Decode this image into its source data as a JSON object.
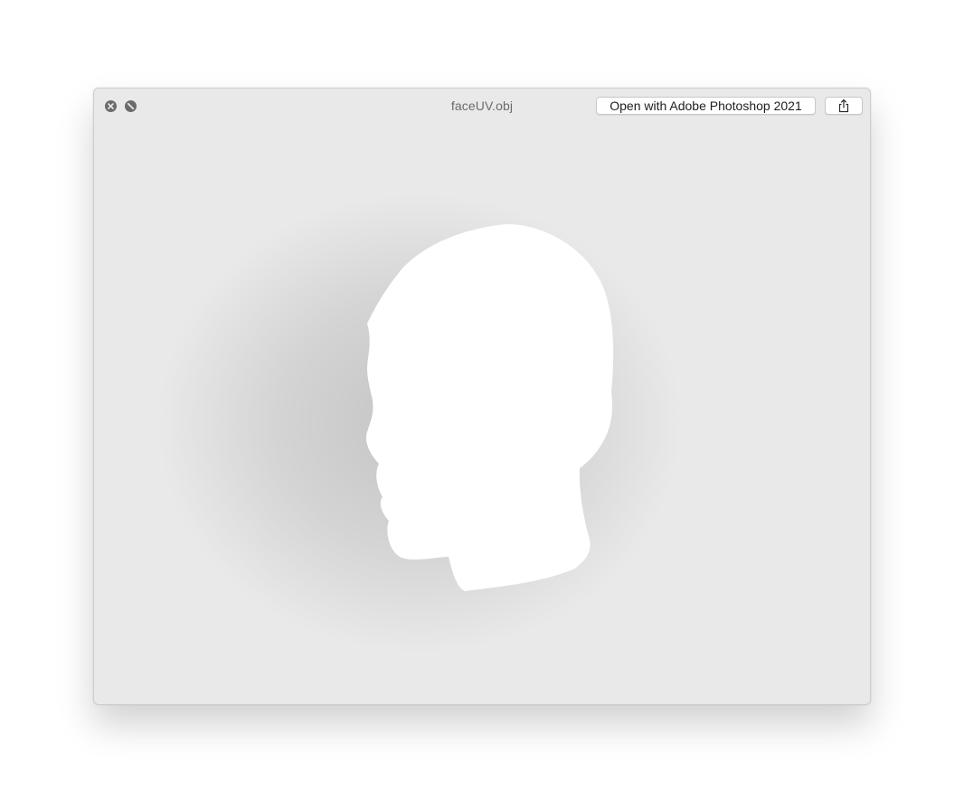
{
  "window": {
    "title": "faceUV.obj",
    "open_with_label": "Open with Adobe Photoshop 2021"
  },
  "icons": {
    "close": "close-icon",
    "fullscreen": "fullscreen-icon",
    "share": "share-icon",
    "preview": "head-silhouette"
  },
  "colors": {
    "window_bg": "#e9e9e9",
    "silhouette": "#ffffff",
    "title_text": "#6b6b6b"
  }
}
